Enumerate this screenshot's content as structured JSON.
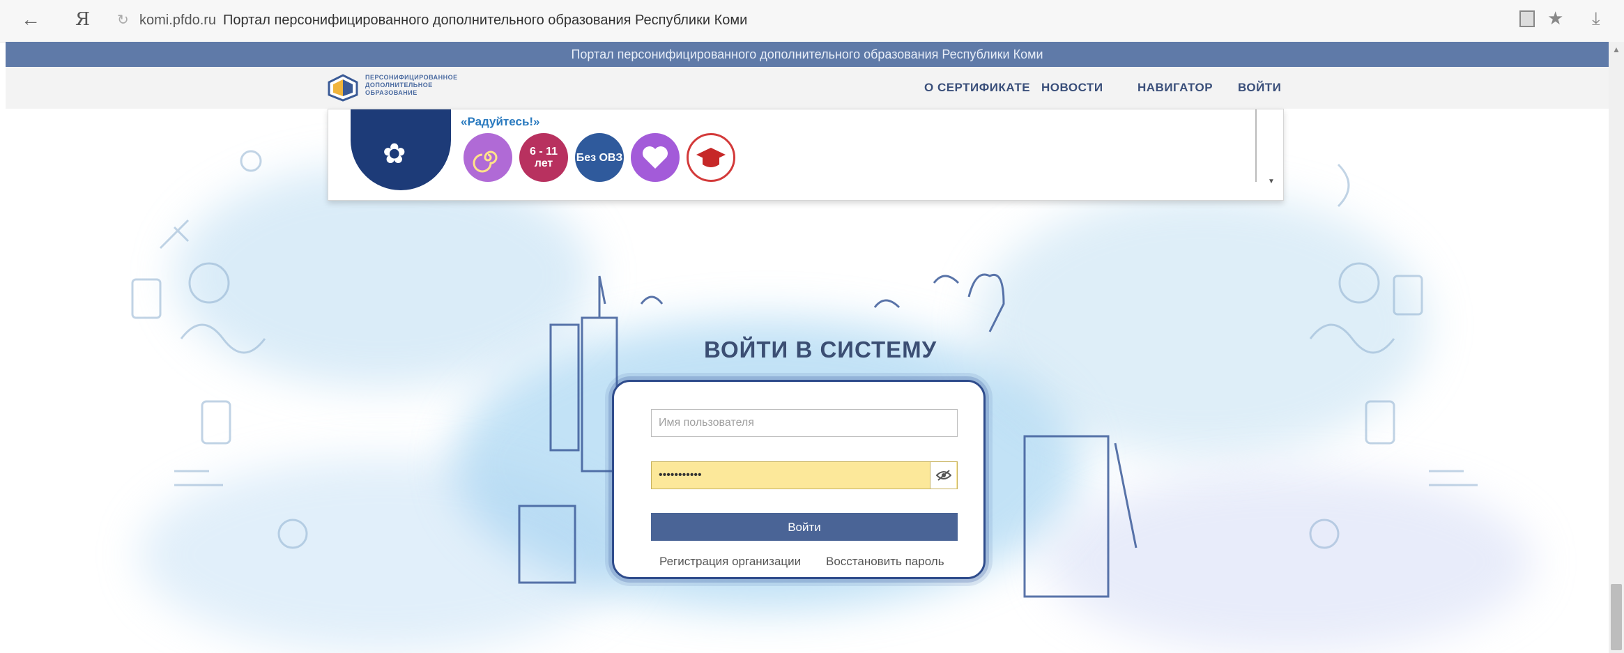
{
  "browser": {
    "url": "komi.pfdo.ru",
    "tab_title": "Портал персонифицированного дополнительного образования Республики Коми",
    "ya_label": "Я"
  },
  "site": {
    "banner_text": "Портал персонифицированного дополнительного образования Республики Коми",
    "logo_lines": [
      "ПЕРСОНИФИЦИРОВАННОЕ",
      "ДОПОЛНИТЕЛЬНОЕ",
      "ОБРАЗОВАНИЕ"
    ],
    "nav": [
      {
        "label": "О СЕРТИФИКАТЕ"
      },
      {
        "label": "НОВОСТИ"
      },
      {
        "label": "НАВИГАТОР"
      },
      {
        "label": "ВОЙТИ"
      }
    ]
  },
  "program_card": {
    "title": "«Радуйтесь!»",
    "badges": [
      {
        "label": "",
        "color": "#b06ad6"
      },
      {
        "label": "6 - 11 лет",
        "color": "#b8315f"
      },
      {
        "label": "Без ОВЗ",
        "color": "#2f5a9c"
      },
      {
        "label": "",
        "color": "#a35bd9"
      },
      {
        "label": "",
        "color": "#ffffff"
      }
    ]
  },
  "login": {
    "title": "ВОЙТИ В СИСТЕМУ",
    "username_placeholder": "Имя пользователя",
    "password_value": "•••••••••••",
    "submit_label": "Войти",
    "register_link": "Регистрация организации",
    "restore_link": "Восстановить пароль"
  },
  "colors": {
    "banner": "#5f7aa8",
    "button": "#4a6496",
    "password_fill": "#fce89a",
    "heading": "#3b4e73"
  }
}
